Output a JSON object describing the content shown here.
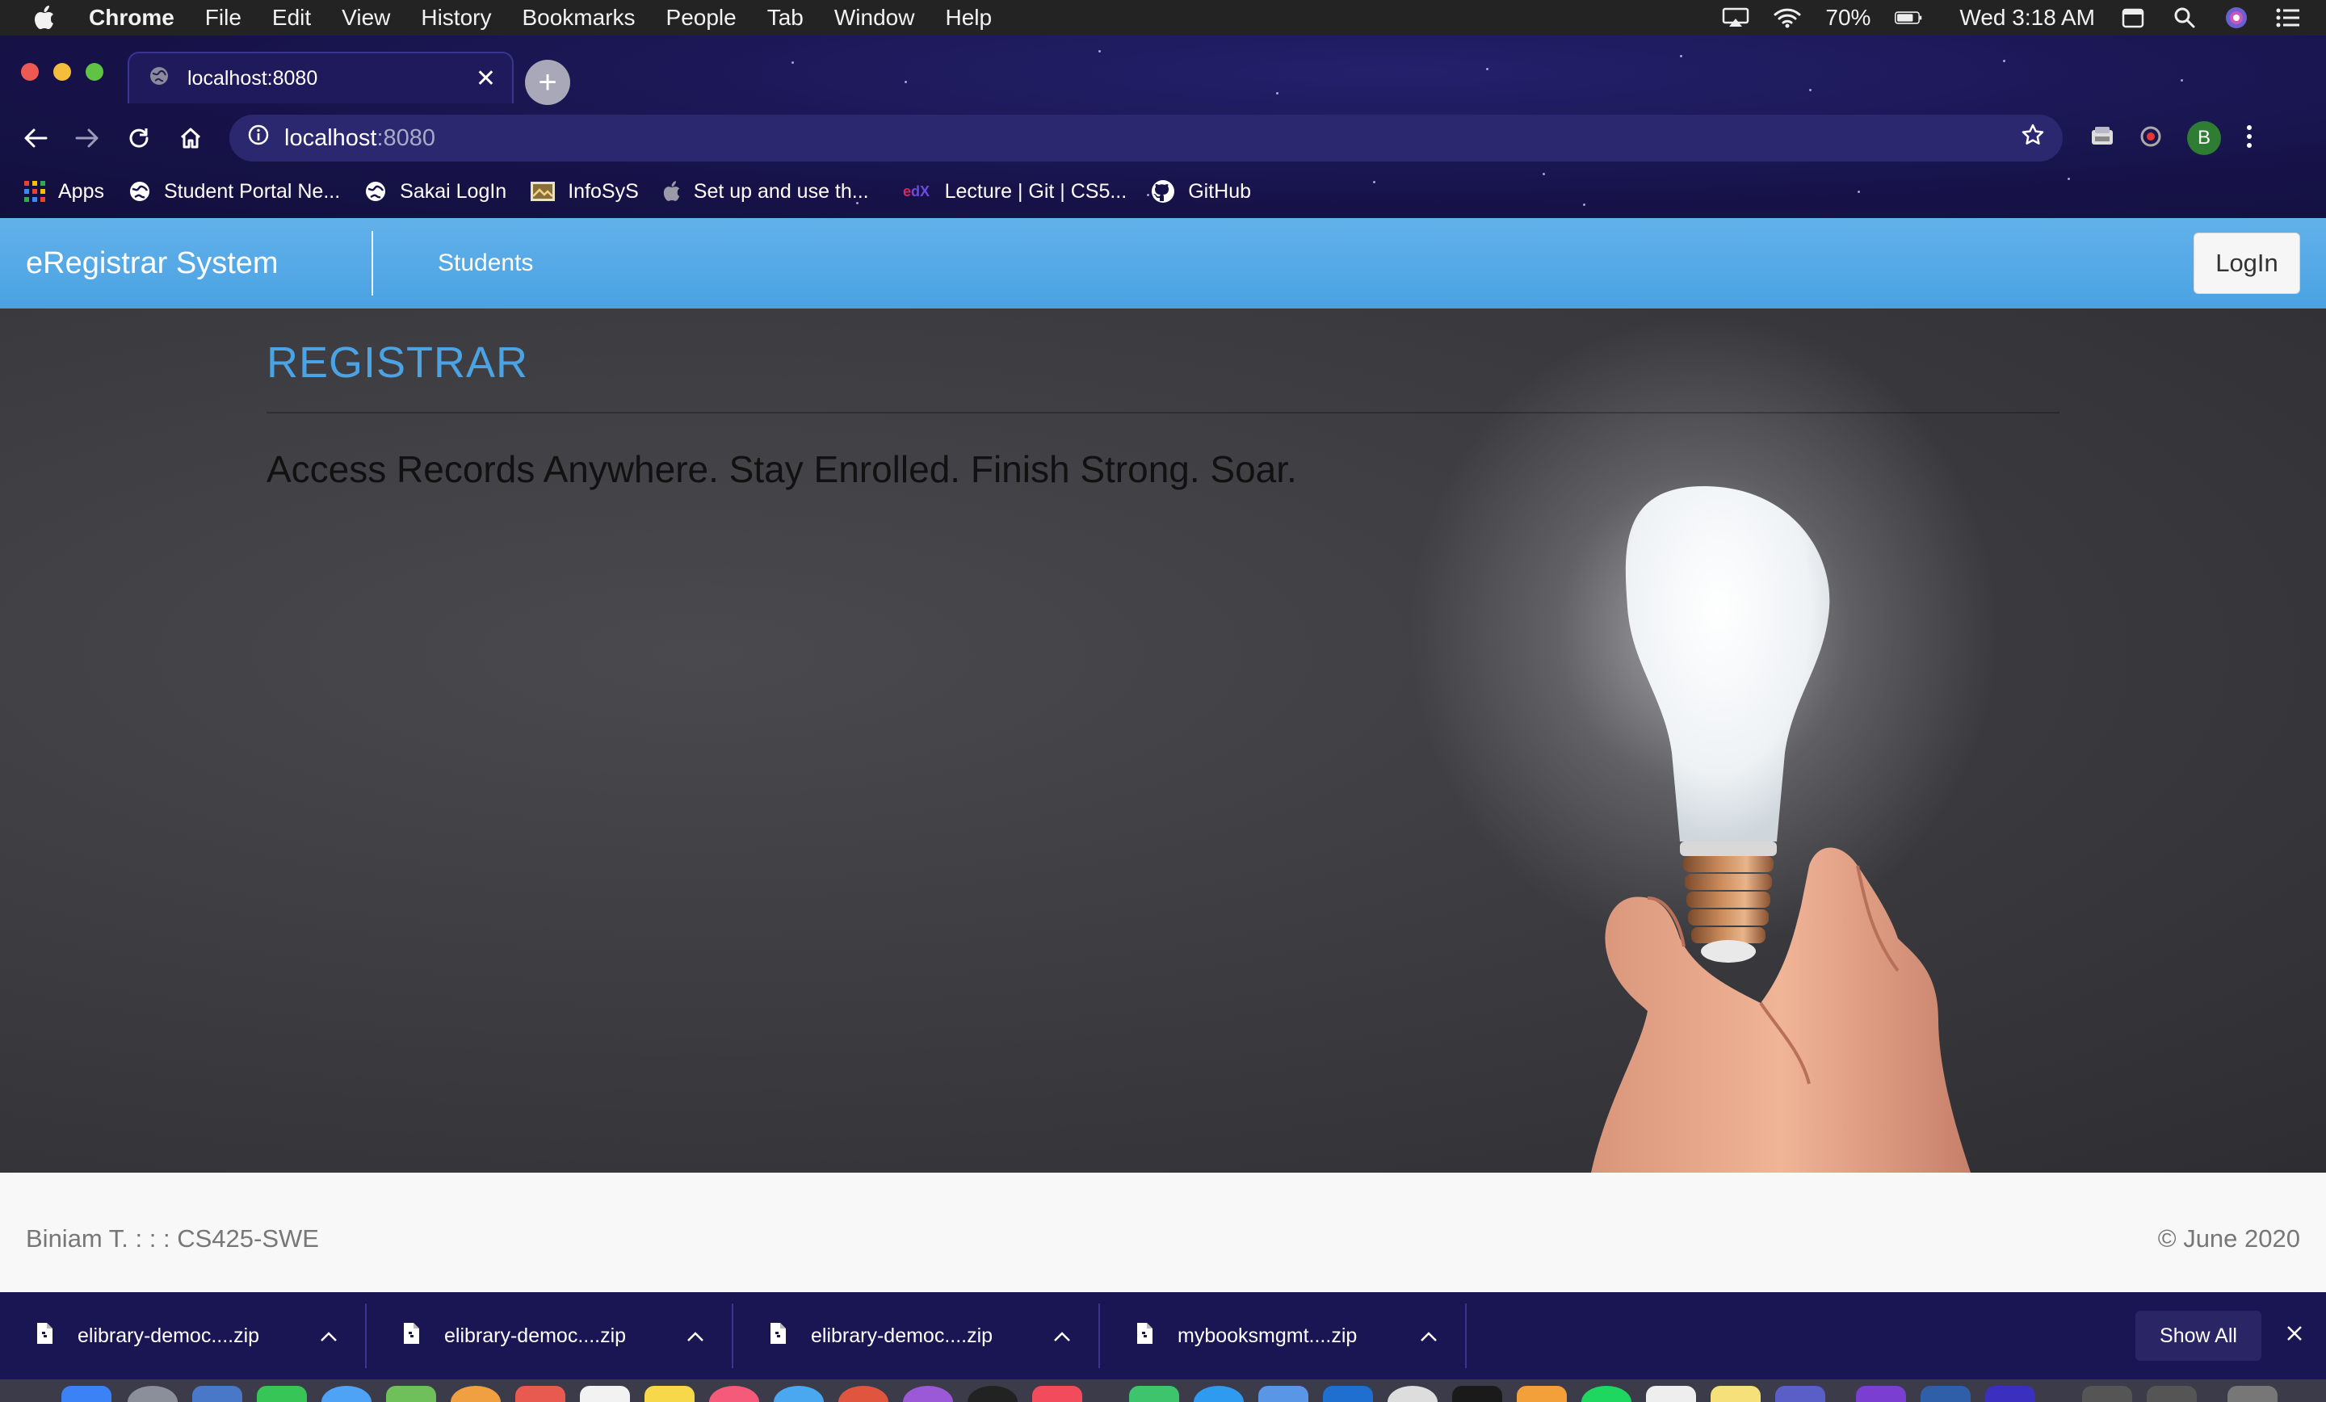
{
  "menubar": {
    "items": [
      "Chrome",
      "File",
      "Edit",
      "View",
      "History",
      "Bookmarks",
      "People",
      "Tab",
      "Window",
      "Help"
    ],
    "battery": "70%",
    "clock": "Wed 3:18 AM"
  },
  "browser": {
    "tab_title": "localhost:8080",
    "url_host": "localhost",
    "url_port": ":8080",
    "profile_initial": "B",
    "bookmarks": [
      "Apps",
      "Student Portal Ne...",
      "Sakai LogIn",
      "InfoSyS",
      "Set up and use th...",
      "Lecture | Git | CS5...",
      "GitHub"
    ]
  },
  "page": {
    "brand": "eRegistrar System",
    "nav_students": "Students",
    "login_label": "LogIn",
    "hero_title": "REGISTRAR",
    "hero_lead": "Access Records Anywhere. Stay Enrolled. Finish Strong. Soar.",
    "footer_left": "Biniam T. : : : CS425-SWE",
    "footer_right": "© June 2020"
  },
  "downloads": {
    "items": [
      "elibrary-democ....zip",
      "elibrary-democ....zip",
      "elibrary-democ....zip",
      "mybooksmgmt....zip"
    ],
    "show_all": "Show All"
  },
  "colors": {
    "navbar": "#55a8e6",
    "hero_title": "#4ba3e3",
    "chrome_bg": "#17134a"
  }
}
